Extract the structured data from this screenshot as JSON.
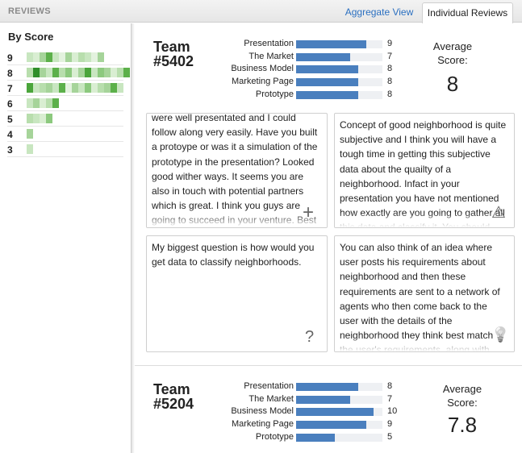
{
  "header": {
    "title": "REVIEWS",
    "tabs": [
      {
        "label": "Aggregate View",
        "active": false
      },
      {
        "label": "Individual Reviews",
        "active": true
      }
    ]
  },
  "sidebar": {
    "heading": "By Score",
    "rows": [
      {
        "score": "9",
        "cells": [
          "#c8e6c0",
          "#d9eed2",
          "#a6d49a",
          "#5cb04a",
          "#c8e6c0",
          "#e3f2de",
          "#a6d49a",
          "#d9eed2",
          "#b8dead",
          "#c8e6c0",
          "#e3f2de",
          "#a6d49a"
        ]
      },
      {
        "score": "8",
        "cells": [
          "#b8dead",
          "#2f8f2a",
          "#a6d49a",
          "#c8e6c0",
          "#5cb04a",
          "#b8dead",
          "#8cc97e",
          "#d9eed2",
          "#a6d49a",
          "#4aa53b",
          "#c8e6c0",
          "#8cc97e",
          "#a6d49a",
          "#d9eed2",
          "#b8dead",
          "#5cb04a"
        ]
      },
      {
        "score": "7",
        "cells": [
          "#4aa53b",
          "#c8e6c0",
          "#b8dead",
          "#a6d49a",
          "#c8e6c0",
          "#5cb04a",
          "#e3f2de",
          "#a6d49a",
          "#c8e6c0",
          "#8cc97e",
          "#d9eed2",
          "#b8dead",
          "#a6d49a",
          "#5cb04a",
          "#c8e6c0"
        ]
      },
      {
        "score": "6",
        "cells": [
          "#c8e6c0",
          "#a6d49a",
          "#d9eed2",
          "#b8dead",
          "#5cb04a"
        ]
      },
      {
        "score": "5",
        "cells": [
          "#b8dead",
          "#c8e6c0",
          "#d9eed2",
          "#8cc97e"
        ]
      },
      {
        "score": "4",
        "cells": [
          "#a6d49a"
        ]
      },
      {
        "score": "3",
        "cells": [
          "#c8e6c0"
        ]
      }
    ]
  },
  "teams": [
    {
      "name_line1": "Team",
      "name_line2": "#5402",
      "average_label_1": "Average",
      "average_label_2": "Score:",
      "average": "8",
      "criteria": [
        {
          "label": "Presentation",
          "value": 9
        },
        {
          "label": "The Market",
          "value": 7
        },
        {
          "label": "Business Model",
          "value": 8
        },
        {
          "label": "Marketing Page",
          "value": 8
        },
        {
          "label": "Prototype",
          "value": 8
        }
      ],
      "max_score": 10
    },
    {
      "name_line1": "Team",
      "name_line2": "#5204",
      "average_label_1": "Average",
      "average_label_2": "Score:",
      "average": "7.8",
      "criteria": [
        {
          "label": "Presentation",
          "value": 8
        },
        {
          "label": "The Market",
          "value": 7
        },
        {
          "label": "Business Model",
          "value": 10
        },
        {
          "label": "Marketing Page",
          "value": 9
        },
        {
          "label": "Prototype",
          "value": 5
        }
      ],
      "max_score": 10
    }
  ],
  "comments": [
    {
      "text": "were well presentated and I could follow along very easily. Have you built a protoype or was it a simulation of the prototype in the presentation? Looked good wither ways. It seems you are also in touch with potential partners which is great. I think you guys are going to succeed in your venture. Best of luck.",
      "icon": "plus-icon",
      "glyph": "+"
    },
    {
      "text": "Concept of good neighborhood is quite subjective and I think you will have a tough time in getting this subjective data about the quailty of a neighborhood. Infact in your presentation you have not mentioned how exactly are you going to gather all this data and classify it. You should",
      "icon": "warning-icon",
      "glyph": "⚠"
    },
    {
      "text": "My biggest question is how would you get data to classify neighborhoods.",
      "icon": "question-icon",
      "glyph": "?"
    },
    {
      "text": "You can also think of an idea where user posts his requirements about neighborhood and then these requirements are sent to a network of agents who then come back to the user with the details of the neighborhood they think best match the user's requirements, along with deals. This",
      "icon": "lightbulb-icon",
      "glyph": "💡"
    }
  ]
}
